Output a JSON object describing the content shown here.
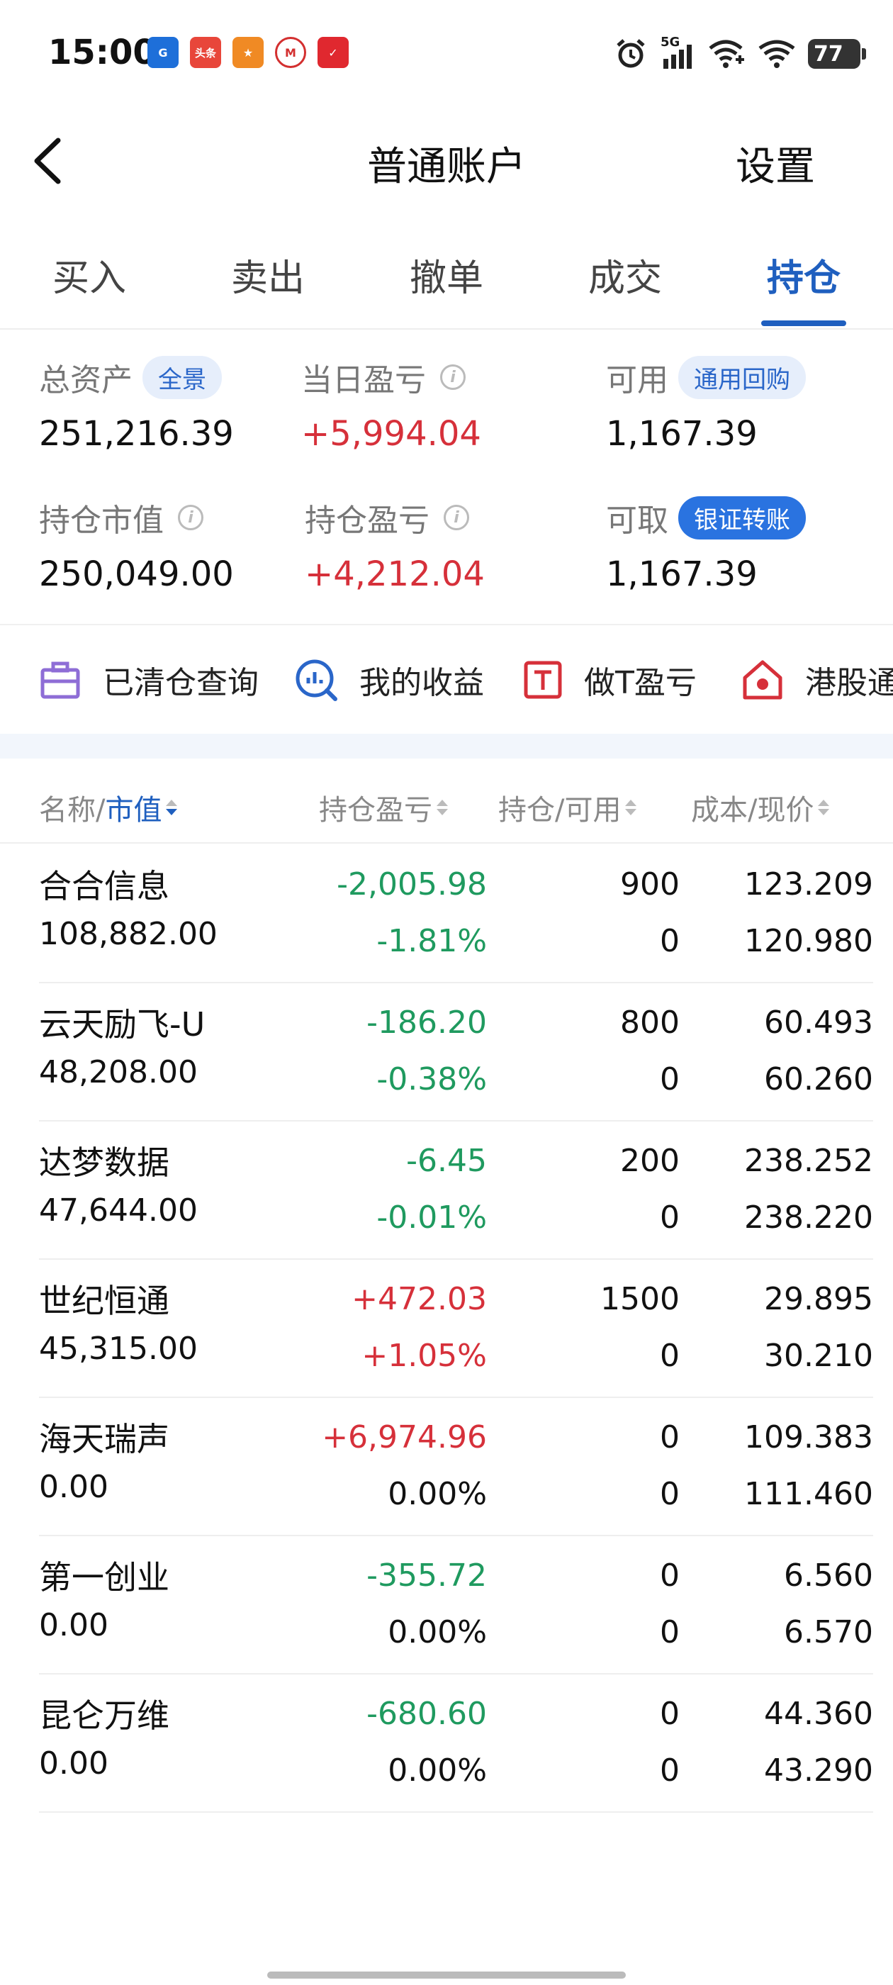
{
  "status_bar": {
    "time": "15:00",
    "apps": [
      {
        "name": "broker-app-icon",
        "label": "",
        "color": "#1e6fd9"
      },
      {
        "name": "toutiao-app-icon",
        "label": "头条",
        "color": "#e8463a"
      },
      {
        "name": "app-orange-icon",
        "label": "",
        "color": "#f08a24"
      },
      {
        "name": "bank-app-icon",
        "label": "",
        "color": "#d32f2f"
      },
      {
        "name": "app-red-icon",
        "label": "",
        "color": "#e0282f"
      }
    ],
    "network": "5G",
    "battery": "77"
  },
  "nav": {
    "title": "普通账户",
    "settings": "设置"
  },
  "tabs": [
    {
      "label": "买入",
      "active": false
    },
    {
      "label": "卖出",
      "active": false
    },
    {
      "label": "撤单",
      "active": false
    },
    {
      "label": "成交",
      "active": false
    },
    {
      "label": "持仓",
      "active": true
    }
  ],
  "summary": {
    "total_assets": {
      "label": "总资产",
      "tag": "全景",
      "value": "251,216.39"
    },
    "daily_pl": {
      "label": "当日盈亏",
      "value": "+5,994.04"
    },
    "available": {
      "label": "可用",
      "tag": "通用回购",
      "value": "1,167.39"
    },
    "market_value": {
      "label": "持仓市值",
      "value": "250,049.00"
    },
    "position_pl": {
      "label": "持仓盈亏",
      "value": "+4,212.04"
    },
    "withdrawable": {
      "label": "可取",
      "tag": "银证转账",
      "value": "1,167.39"
    }
  },
  "quick_menu": [
    {
      "label": "已清仓查询",
      "icon": "briefcase-icon"
    },
    {
      "label": "我的收益",
      "icon": "chart-search-icon"
    },
    {
      "label": "做T盈亏",
      "icon": "t-box-icon"
    },
    {
      "label": "港股通",
      "icon": "hk-flower-icon"
    }
  ],
  "table": {
    "headers": {
      "name": "名称/",
      "market_value": "市值",
      "pl": "持仓盈亏",
      "qty": "持仓/可用",
      "price": "成本/现价"
    },
    "rows": [
      {
        "name": "合合信息",
        "market_value": "108,882.00",
        "pl": "-2,005.98",
        "pl_pct": "-1.81%",
        "qty": "900",
        "avail": "0",
        "cost": "123.209",
        "price": "120.980",
        "trend": "down"
      },
      {
        "name": "云天励飞-U",
        "market_value": "48,208.00",
        "pl": "-186.20",
        "pl_pct": "-0.38%",
        "qty": "800",
        "avail": "0",
        "cost": "60.493",
        "price": "60.260",
        "trend": "down"
      },
      {
        "name": "达梦数据",
        "market_value": "47,644.00",
        "pl": "-6.45",
        "pl_pct": "-0.01%",
        "qty": "200",
        "avail": "0",
        "cost": "238.252",
        "price": "238.220",
        "trend": "down"
      },
      {
        "name": "世纪恒通",
        "market_value": "45,315.00",
        "pl": "+472.03",
        "pl_pct": "+1.05%",
        "qty": "1500",
        "avail": "0",
        "cost": "29.895",
        "price": "30.210",
        "trend": "up"
      },
      {
        "name": "海天瑞声",
        "market_value": "0.00",
        "pl": "+6,974.96",
        "pl_pct": "0.00%",
        "qty": "0",
        "avail": "0",
        "cost": "109.383",
        "price": "111.460",
        "trend": "up"
      },
      {
        "name": "第一创业",
        "market_value": "0.00",
        "pl": "-355.72",
        "pl_pct": "0.00%",
        "qty": "0",
        "avail": "0",
        "cost": "6.560",
        "price": "6.570",
        "trend": "down"
      },
      {
        "name": "昆仑万维",
        "market_value": "0.00",
        "pl": "-680.60",
        "pl_pct": "0.00%",
        "qty": "0",
        "avail": "0",
        "cost": "44.360",
        "price": "43.290",
        "trend": "down"
      }
    ]
  },
  "colors": {
    "accent": "#1f5fbf",
    "up": "#d6303a",
    "down": "#1f9a5f"
  }
}
